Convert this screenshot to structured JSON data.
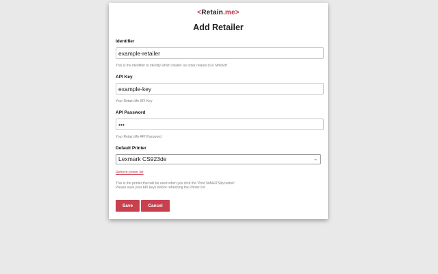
{
  "brand": {
    "name": "Retain",
    "suffix": ".me",
    "accent_color": "#c43a4c"
  },
  "title": "Add Retailer",
  "fields": {
    "identifier": {
      "label": "Identifier",
      "value": "example-retailer",
      "help": "This is the identifier to identify which retailer an order relates to in Mintsoft"
    },
    "api_key": {
      "label": "API Key",
      "value": "example-key",
      "help": "Your Retain.Me API Key"
    },
    "api_password": {
      "label": "API Password",
      "value": "•••",
      "help": "Your Retain.Me API Password"
    },
    "default_printer": {
      "label": "Default Printer",
      "selected": "Lexmark CS923de",
      "refresh_link": "Refresh printer list",
      "help_line1": "This is the printer that will be used when you click the 'Print SMARTSlip button'.",
      "help_line2": "Please save your API keys before refreshing the Printer list"
    }
  },
  "buttons": {
    "save": "Save",
    "cancel": "Cancel"
  }
}
